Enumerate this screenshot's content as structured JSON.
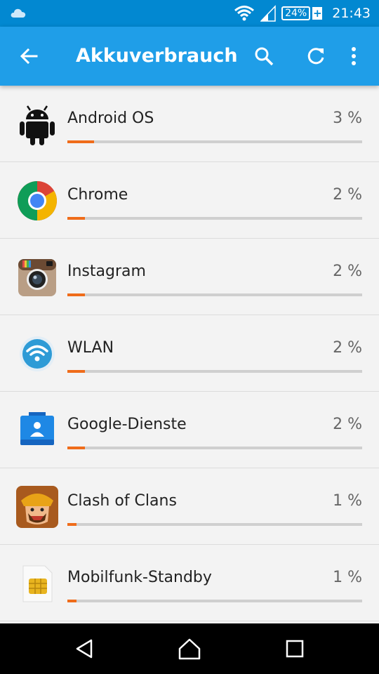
{
  "status": {
    "battery": "24%",
    "time": "21:43"
  },
  "appbar": {
    "title": "Akkuverbrauch"
  },
  "items": [
    {
      "name": "Android OS",
      "percent": "3 %",
      "value": 3,
      "icon": "android-icon"
    },
    {
      "name": "Chrome",
      "percent": "2 %",
      "value": 2,
      "icon": "chrome-icon"
    },
    {
      "name": "Instagram",
      "percent": "2 %",
      "value": 2,
      "icon": "instagram-icon"
    },
    {
      "name": "WLAN",
      "percent": "2 %",
      "value": 2,
      "icon": "wifi-icon"
    },
    {
      "name": "Google-Dienste",
      "percent": "2 %",
      "value": 2,
      "icon": "google-services-icon"
    },
    {
      "name": "Clash of Clans",
      "percent": "1 %",
      "value": 1,
      "icon": "clash-of-clans-icon"
    },
    {
      "name": "Mobilfunk-Standby",
      "percent": "1 %",
      "value": 1,
      "icon": "sim-card-icon"
    }
  ],
  "colors": {
    "statusbar": "#0288d1",
    "appbar": "#1f9ee8",
    "usage_bar": "#ef6c1a",
    "track": "#cfcfcf"
  }
}
